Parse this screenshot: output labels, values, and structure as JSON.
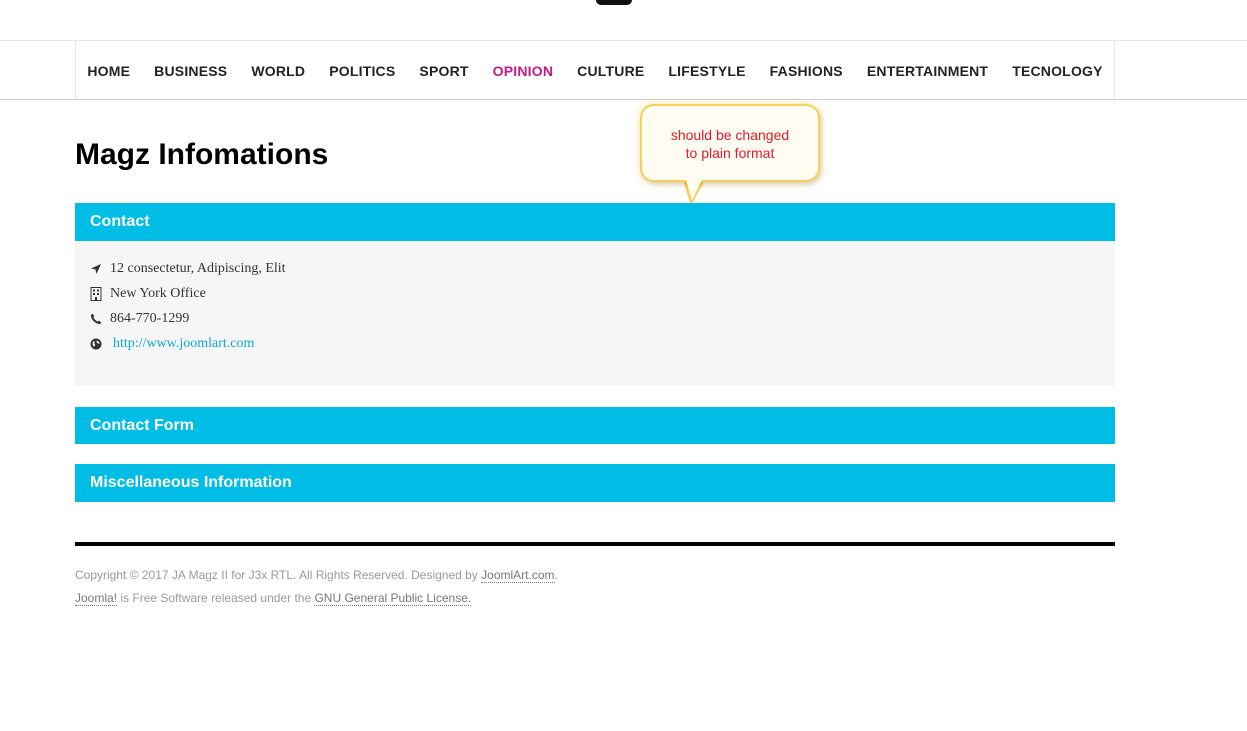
{
  "nav": {
    "items": [
      {
        "label": "HOME"
      },
      {
        "label": "BUSINESS"
      },
      {
        "label": "WORLD"
      },
      {
        "label": "POLITICS"
      },
      {
        "label": "SPORT"
      },
      {
        "label": "OPINION"
      },
      {
        "label": "CULTURE"
      },
      {
        "label": "LIFESTYLE"
      },
      {
        "label": "FASHIONS"
      },
      {
        "label": "ENTERTAINMENT"
      },
      {
        "label": "TECNOLOGY"
      }
    ],
    "active_index": 5,
    "active_color": "#c8178a"
  },
  "page": {
    "title": "Magz Infomations"
  },
  "callout": {
    "line1": "should be changed",
    "line2": "to plain format",
    "text_color": "#e3182d",
    "border_color": "#f6cf5c"
  },
  "panels": {
    "contact": {
      "title": "Contact",
      "address": "12 consectetur, Adipiscing, Elit",
      "office": "New York Office",
      "phone": "864-770-1299",
      "website": "http://www.joomlart.com",
      "icons": [
        "location-arrow-icon",
        "building-icon",
        "phone-icon",
        "globe-icon"
      ]
    },
    "contact_form": {
      "title": "Contact Form"
    },
    "misc": {
      "title": "Miscellaneous Information"
    },
    "header_color": "#00bde5"
  },
  "footer": {
    "copyright_prefix": "Copyright © 2017 JA Magz II for J3x RTL. All Rights Reserved. Designed by ",
    "designer_link": "JoomlArt.com",
    "copyright_suffix": ".",
    "joomla_link": "Joomla!",
    "license_middle": " is Free Software released under the ",
    "license_link": "GNU General Public License."
  }
}
